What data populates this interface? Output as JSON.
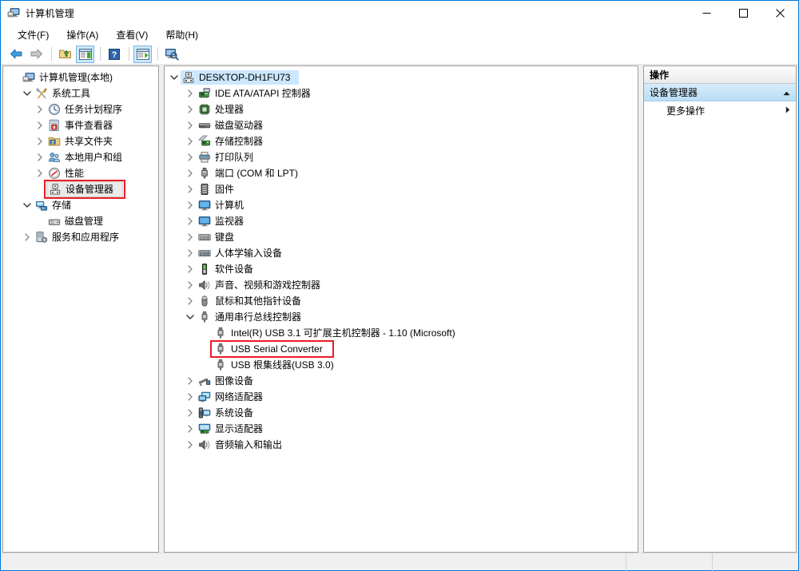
{
  "window": {
    "title": "计算机管理",
    "icon": "computer-management-icon",
    "controls": {
      "minimize": "–",
      "maximize": "□",
      "close": "✕"
    }
  },
  "menubar": {
    "items": [
      {
        "label": "文件(F)",
        "name": "menu-file"
      },
      {
        "label": "操作(A)",
        "name": "menu-action"
      },
      {
        "label": "查看(V)",
        "name": "menu-view"
      },
      {
        "label": "帮助(H)",
        "name": "menu-help"
      }
    ]
  },
  "toolbar": {
    "buttons": [
      {
        "name": "back-arrow-icon",
        "title": "后退"
      },
      {
        "name": "forward-arrow-icon",
        "title": "前进"
      },
      {
        "name": "up-folder-icon",
        "title": "向上"
      },
      {
        "name": "show-console-tree-icon",
        "title": "显示/隐藏控制台树"
      },
      {
        "name": "help-icon",
        "title": "帮助"
      },
      {
        "name": "properties-icon",
        "title": "属性"
      },
      {
        "name": "scan-hardware-icon",
        "title": "扫描检测硬件改动"
      }
    ]
  },
  "console_tree": {
    "items": [
      {
        "label": "计算机管理(本地)",
        "indent": 0,
        "twisty": "none",
        "icon": "computer-management-icon",
        "selected": "none"
      },
      {
        "label": "系统工具",
        "indent": 1,
        "twisty": "expanded",
        "icon": "system-tools-icon",
        "selected": "none"
      },
      {
        "label": "任务计划程序",
        "indent": 2,
        "twisty": "collapsed",
        "icon": "task-scheduler-icon",
        "selected": "none"
      },
      {
        "label": "事件查看器",
        "indent": 2,
        "twisty": "collapsed",
        "icon": "event-viewer-icon",
        "selected": "none"
      },
      {
        "label": "共享文件夹",
        "indent": 2,
        "twisty": "collapsed",
        "icon": "shared-folders-icon",
        "selected": "none"
      },
      {
        "label": "本地用户和组",
        "indent": 2,
        "twisty": "collapsed",
        "icon": "local-users-groups-icon",
        "selected": "none"
      },
      {
        "label": "性能",
        "indent": 2,
        "twisty": "collapsed",
        "icon": "performance-icon",
        "selected": "none"
      },
      {
        "label": "设备管理器",
        "indent": 2,
        "twisty": "none",
        "icon": "device-manager-icon",
        "selected": "gray",
        "highlight": "red"
      },
      {
        "label": "存储",
        "indent": 1,
        "twisty": "expanded",
        "icon": "storage-icon",
        "selected": "none"
      },
      {
        "label": "磁盘管理",
        "indent": 2,
        "twisty": "none",
        "icon": "disk-management-icon",
        "selected": "none"
      },
      {
        "label": "服务和应用程序",
        "indent": 1,
        "twisty": "collapsed",
        "icon": "services-applications-icon",
        "selected": "none"
      }
    ]
  },
  "device_tree": {
    "items": [
      {
        "label": "DESKTOP-DH1FU73",
        "indent": 0,
        "twisty": "expanded",
        "icon": "computer-root-icon",
        "selected": "blue"
      },
      {
        "label": "IDE ATA/ATAPI 控制器",
        "indent": 1,
        "twisty": "collapsed",
        "icon": "ide-controller-icon",
        "selected": "none"
      },
      {
        "label": "处理器",
        "indent": 1,
        "twisty": "collapsed",
        "icon": "processor-icon",
        "selected": "none"
      },
      {
        "label": "磁盘驱动器",
        "indent": 1,
        "twisty": "collapsed",
        "icon": "disk-drive-icon",
        "selected": "none"
      },
      {
        "label": "存储控制器",
        "indent": 1,
        "twisty": "collapsed",
        "icon": "storage-controller-icon",
        "selected": "none"
      },
      {
        "label": "打印队列",
        "indent": 1,
        "twisty": "collapsed",
        "icon": "print-queue-icon",
        "selected": "none"
      },
      {
        "label": "端口 (COM 和 LPT)",
        "indent": 1,
        "twisty": "collapsed",
        "icon": "port-icon",
        "selected": "none"
      },
      {
        "label": "固件",
        "indent": 1,
        "twisty": "collapsed",
        "icon": "firmware-icon",
        "selected": "none"
      },
      {
        "label": "计算机",
        "indent": 1,
        "twisty": "collapsed",
        "icon": "computer-icon",
        "selected": "none"
      },
      {
        "label": "监视器",
        "indent": 1,
        "twisty": "collapsed",
        "icon": "monitor-icon",
        "selected": "none"
      },
      {
        "label": "键盘",
        "indent": 1,
        "twisty": "collapsed",
        "icon": "keyboard-icon",
        "selected": "none"
      },
      {
        "label": "人体学输入设备",
        "indent": 1,
        "twisty": "collapsed",
        "icon": "hid-icon",
        "selected": "none"
      },
      {
        "label": "软件设备",
        "indent": 1,
        "twisty": "collapsed",
        "icon": "software-device-icon",
        "selected": "none"
      },
      {
        "label": "声音、视频和游戏控制器",
        "indent": 1,
        "twisty": "collapsed",
        "icon": "sound-video-game-icon",
        "selected": "none"
      },
      {
        "label": "鼠标和其他指针设备",
        "indent": 1,
        "twisty": "collapsed",
        "icon": "mouse-icon",
        "selected": "none"
      },
      {
        "label": "通用串行总线控制器",
        "indent": 1,
        "twisty": "expanded",
        "icon": "usb-controller-icon",
        "selected": "none"
      },
      {
        "label": "Intel(R) USB 3.1 可扩展主机控制器 - 1.10 (Microsoft)",
        "indent": 2,
        "twisty": "none",
        "icon": "usb-device-icon",
        "selected": "none"
      },
      {
        "label": "USB Serial Converter",
        "indent": 2,
        "twisty": "none",
        "icon": "usb-device-icon",
        "selected": "none",
        "highlight": "red"
      },
      {
        "label": "USB 根集线器(USB 3.0)",
        "indent": 2,
        "twisty": "none",
        "icon": "usb-device-icon",
        "selected": "none"
      },
      {
        "label": "图像设备",
        "indent": 1,
        "twisty": "collapsed",
        "icon": "imaging-device-icon",
        "selected": "none"
      },
      {
        "label": "网络适配器",
        "indent": 1,
        "twisty": "collapsed",
        "icon": "network-adapter-icon",
        "selected": "none"
      },
      {
        "label": "系统设备",
        "indent": 1,
        "twisty": "collapsed",
        "icon": "system-device-icon",
        "selected": "none"
      },
      {
        "label": "显示适配器",
        "indent": 1,
        "twisty": "collapsed",
        "icon": "display-adapter-icon",
        "selected": "none"
      },
      {
        "label": "音频输入和输出",
        "indent": 1,
        "twisty": "collapsed",
        "icon": "audio-io-icon",
        "selected": "none"
      }
    ]
  },
  "actions_pane": {
    "header": "操作",
    "group_label": "设备管理器",
    "group_chevron": "chevron-up-icon",
    "rows": [
      {
        "label": "更多操作",
        "arrow": "chevron-right-icon",
        "name": "action-more-actions"
      }
    ]
  },
  "statusbar": {
    "text": ""
  },
  "colors": {
    "window_border": "#0078d7",
    "selection_blue": "#cce8ff",
    "selection_gray": "#eaeaea",
    "annotation_red": "#ee1c25",
    "actions_group_bg": "#b9ddf6"
  }
}
